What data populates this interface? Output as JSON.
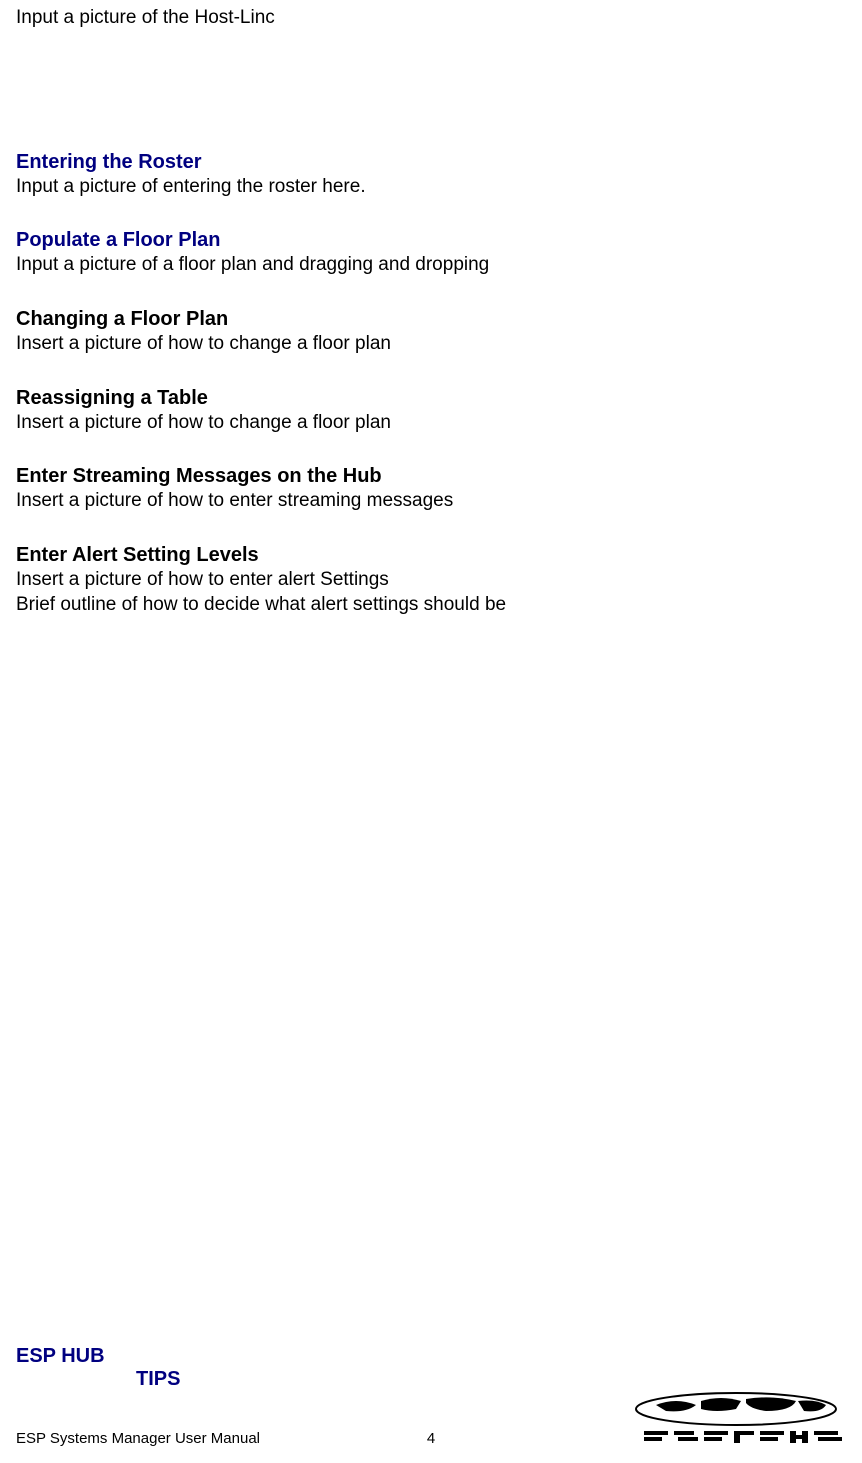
{
  "top_text": "Input a picture of the Host-Linc",
  "sections": {
    "s1": {
      "heading": "Entering the Roster",
      "body1": "Input a picture of entering the roster here."
    },
    "s2": {
      "heading": "Populate a Floor Plan",
      "body1": "Input a picture of a floor plan and dragging and dropping"
    },
    "s3": {
      "heading": "Changing a Floor Plan",
      "body1": "Insert a picture of how to change a floor plan"
    },
    "s4": {
      "heading": "Reassigning a Table",
      "body1": "Insert a picture of how to change a floor plan"
    },
    "s5": {
      "heading": "Enter Streaming Messages on the Hub",
      "body1": "Insert a picture of how to enter streaming messages"
    },
    "s6": {
      "heading": "Enter Alert Setting Levels",
      "body1": "Insert a picture of how to enter alert Settings",
      "body2": "Brief outline of how to decide what alert settings should be"
    }
  },
  "bottom": {
    "heading1": "ESP HUB",
    "heading2": "TIPS"
  },
  "footer": {
    "left": "ESP Systems Manager User Manual",
    "page": "4"
  }
}
